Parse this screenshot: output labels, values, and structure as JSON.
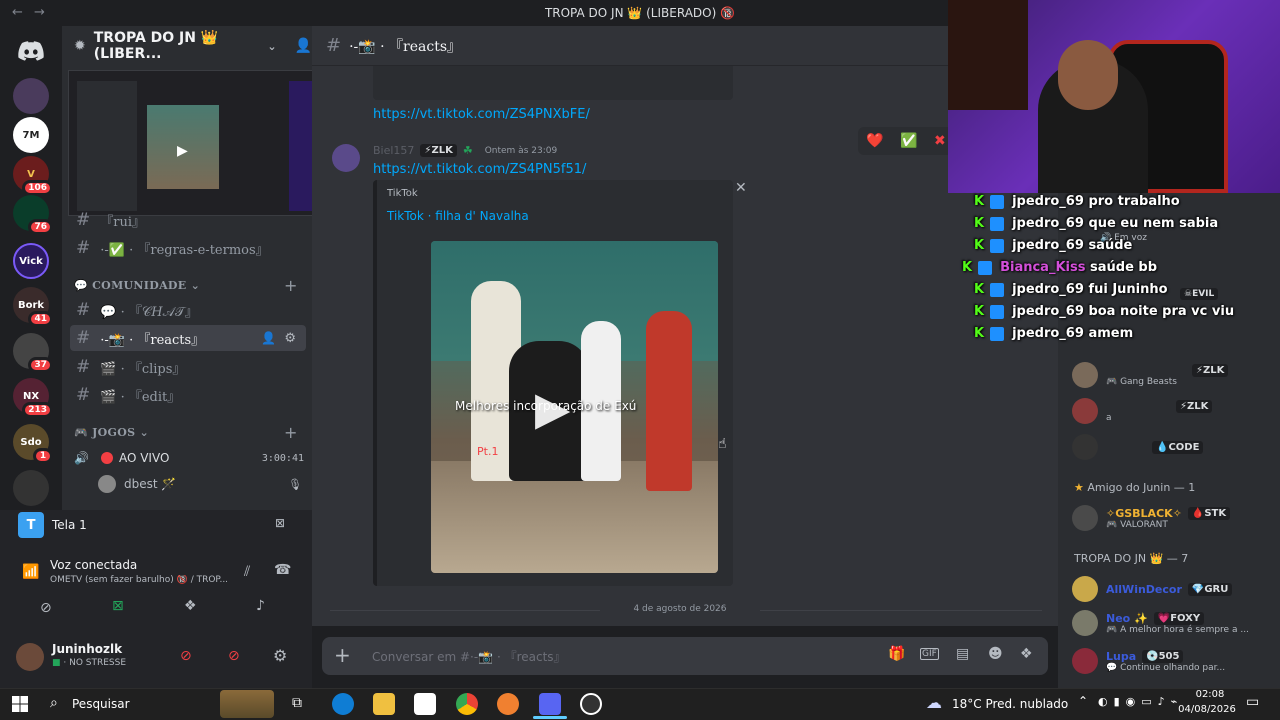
{
  "window": {
    "title": "TROPA DO JN 👑 (LIBERADO) 🔞",
    "back": "←",
    "forward": "→"
  },
  "server": {
    "name": "TROPA DO JN 👑 (LIBER...",
    "rail": [
      {
        "label": "",
        "badge": ""
      },
      {
        "label": "7M",
        "badge": ""
      },
      {
        "label": "V",
        "badge": "106"
      },
      {
        "label": "",
        "badge": "76"
      },
      {
        "label": "Vick",
        "badge": ""
      },
      {
        "label": "Bork",
        "badge": "41"
      },
      {
        "label": "",
        "badge": "37"
      },
      {
        "label": "NX",
        "badge": "213"
      },
      {
        "label": "Sdo",
        "badge": "1"
      },
      {
        "label": "",
        "badge": ""
      }
    ]
  },
  "channels": {
    "top": [
      {
        "name": "『rui』",
        "prefix": "#",
        "icon": "-♪"
      },
      {
        "name": "·-✅ · 『regras-e-termos』",
        "prefix": "#"
      }
    ],
    "community_category": "💬 COMUNIDADE",
    "community": [
      {
        "name": "💬 · 『𝒞𝐻𝒜𝒯』",
        "prefix": "#"
      },
      {
        "name": "·-📸 · 『reacts』",
        "prefix": "#",
        "active": true
      },
      {
        "name": "🎬 · 『clips』",
        "prefix": "#"
      },
      {
        "name": "🎬 · 『edit』",
        "prefix": "#"
      }
    ],
    "games_category": "🎮 JOGOS",
    "voice_channel": "AO VIVO",
    "voice_timer": "3:00:41",
    "voice_user": "dbest 🪄"
  },
  "voice_panel": {
    "screen_label": "Tela 1",
    "status": "Voz conectada",
    "channel": "OMETV (sem fazer barulho) 🔞 / TROP..."
  },
  "user": {
    "name": "Juninhozlk",
    "status": "NO STRESSE"
  },
  "channel_header": {
    "name": "·-📸 · 『reacts』"
  },
  "messages": {
    "link1": "https://vt.tiktok.com/ZS4PNXbFE/",
    "author": "Biel157",
    "author_tag": "⚡ZLK",
    "timestamp": "Ontem às 23:09",
    "link2": "https://vt.tiktok.com/ZS4PN5f51/",
    "embed_provider": "TikTok",
    "embed_title": "TikTok · filha d' Navalha",
    "video_caption": "Melhores incorporação de Exú",
    "video_tag": "Pt.1",
    "date_divider": "4 de agosto de 2026"
  },
  "reactions": [
    "❤️",
    "✅",
    "✖"
  ],
  "composer": {
    "placeholder": "Conversar em #·-📸 · 『reacts』"
  },
  "overlay_chat": [
    {
      "user": "jpedro_69",
      "text": "pro trabalho"
    },
    {
      "user": "jpedro_69",
      "text": "que eu nem sabia"
    },
    {
      "user": "jpedro_69",
      "text": "saúde"
    },
    {
      "user": "Bianca_Kiss",
      "text": "saúde bb"
    },
    {
      "user": "jpedro_69",
      "text": "fui Juninho"
    },
    {
      "user": "jpedro_69",
      "text": "boa noite pra vc viu"
    },
    {
      "user": "jpedro_69",
      "text": "amem"
    }
  ],
  "members": {
    "list": [
      {
        "name": "🎮 Gang Beasts",
        "tag": "⚡ZLK",
        "sub": ""
      },
      {
        "name": "a",
        "tag": "⚡ZLK",
        "sub": ""
      },
      {
        "name": "",
        "tag": "💧CODE",
        "sub": ""
      }
    ],
    "group1": "Amigo do Junin — 1",
    "group1_member": {
      "name": "✧GSBLACK✧",
      "tag": "🩸STK",
      "sub": "🎮 VALORANT"
    },
    "group2": "TROPA DO JN 👑 — 7",
    "group2_members": [
      {
        "name": "AllWinDecor",
        "tag": "💎GRU",
        "sub": ""
      },
      {
        "name": "Neo ✨",
        "tag": "💗FOXY",
        "sub": "🎮 A melhor hora é sempre a ..."
      },
      {
        "name": "Lupa",
        "tag": "💿505",
        "sub": "💬 Continue olhando par..."
      }
    ],
    "evil_tag": "☠EVIL",
    "em_voz": "Em voz"
  },
  "taskbar": {
    "search": "Pesquisar",
    "weather": "18°C  Pred. nublado",
    "time": "02:08",
    "date": "04/08/2026"
  }
}
